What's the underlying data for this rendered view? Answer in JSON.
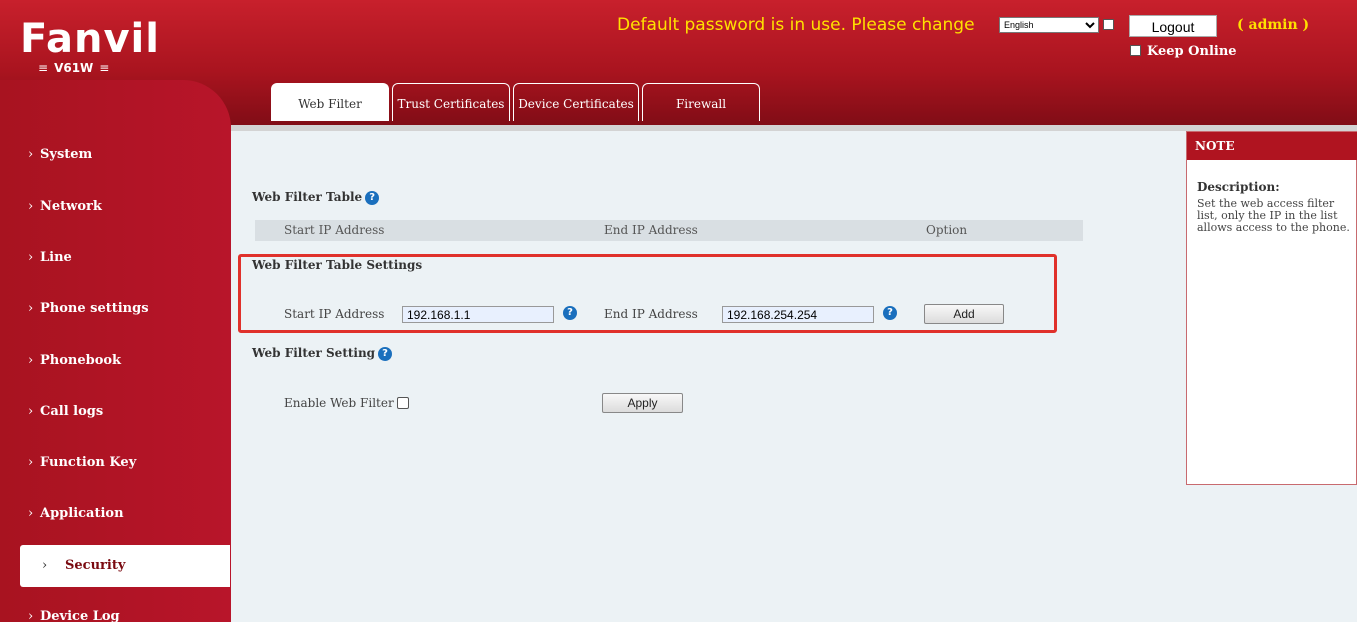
{
  "header": {
    "logo_text": "Fanvil",
    "model": "V61W",
    "banner": "Default password is in use. Please change",
    "language": "English",
    "logout_label": "Logout",
    "user_label": "( admin )",
    "keep_online_label": "Keep Online"
  },
  "sidebar": {
    "items": [
      {
        "label": "System"
      },
      {
        "label": "Network"
      },
      {
        "label": "Line"
      },
      {
        "label": "Phone settings"
      },
      {
        "label": "Phonebook"
      },
      {
        "label": "Call logs"
      },
      {
        "label": "Function Key"
      },
      {
        "label": "Application"
      },
      {
        "label": "Security",
        "active": true
      },
      {
        "label": "Device Log"
      }
    ]
  },
  "tabs": [
    {
      "label": "Web Filter",
      "active": true
    },
    {
      "label": "Trust Certificates"
    },
    {
      "label": "Device Certificates"
    },
    {
      "label": "Firewall"
    }
  ],
  "web_filter_table": {
    "title": "Web Filter Table",
    "columns": [
      "Start IP Address",
      "End IP Address",
      "Option"
    ]
  },
  "table_settings": {
    "title": "Web Filter Table Settings",
    "start_label": "Start IP Address",
    "start_value": "192.168.1.1",
    "end_label": "End IP Address",
    "end_value": "192.168.254.254",
    "add_label": "Add"
  },
  "filter_setting": {
    "title": "Web Filter Setting",
    "enable_label": "Enable Web Filter",
    "enabled": false,
    "apply_label": "Apply"
  },
  "note": {
    "title": "NOTE",
    "desc_title": "Description:",
    "desc": "Set the web access filter list, only the IP in the list allows access to the phone."
  },
  "colors": {
    "brand_red": "#b01420",
    "banner_yellow": "#ffe100",
    "highlight_red": "#e0312b",
    "help_blue": "#1a6fbd"
  }
}
